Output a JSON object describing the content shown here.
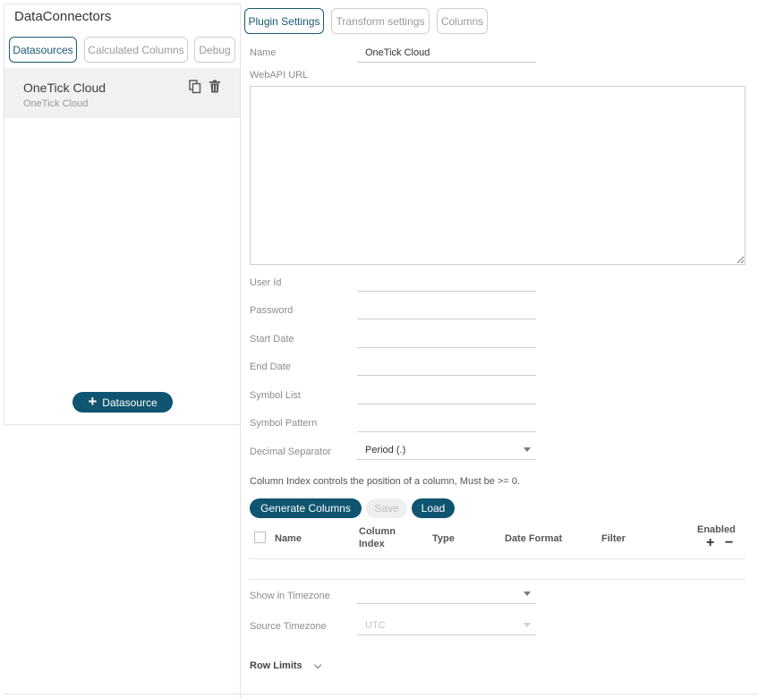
{
  "app": {
    "title": "DataConnectors"
  },
  "left_tabs": [
    {
      "label": "Datasources",
      "active": true
    },
    {
      "label": "Calculated Columns",
      "active": false
    },
    {
      "label": "Debug",
      "active": false
    }
  ],
  "datasource": {
    "name": "OneTick Cloud",
    "subtitle": "OneTick Cloud",
    "icons": [
      "copy-icon",
      "trash-icon"
    ]
  },
  "add_datasource": {
    "label": "Datasource",
    "icon": "plus-icon"
  },
  "top_tabs": [
    {
      "label": "Plugin Settings",
      "active": true
    },
    {
      "label": "Transform settings",
      "active": false
    },
    {
      "label": "Columns",
      "active": false
    }
  ],
  "form": {
    "name_label": "Name",
    "name_value": "OneTick Cloud",
    "webapi_label": "WebAPI URL",
    "webapi_value": "",
    "user_id_label": "User Id",
    "password_label": "Password",
    "start_date_label": "Start Date",
    "end_date_label": "End Date",
    "symbol_list_label": "Symbol List",
    "symbol_pattern_label": "Symbol Pattern",
    "decimal_sep_label": "Decimal Separator",
    "decimal_sep_value": "Period (.)"
  },
  "hint": "Column Index controls the position of a column, Must be >= 0.",
  "buttons": {
    "generate": "Generate Columns",
    "save": "Save",
    "load": "Load"
  },
  "table": {
    "headers": {
      "name": "Name",
      "column_index_1": "Column",
      "column_index_2": "Index",
      "type": "Type",
      "date_format": "Date Format",
      "filter": "Filter",
      "enabled": "Enabled"
    },
    "rows": []
  },
  "timezone": {
    "show_label": "Show in Timezone",
    "show_value": "",
    "source_label": "Source Timezone",
    "source_value": "UTC"
  },
  "row_limits": {
    "label": "Row Limits"
  },
  "colors": {
    "accent": "#0f5470",
    "border": "#cfcfcf",
    "muted": "#9a9a9a"
  }
}
